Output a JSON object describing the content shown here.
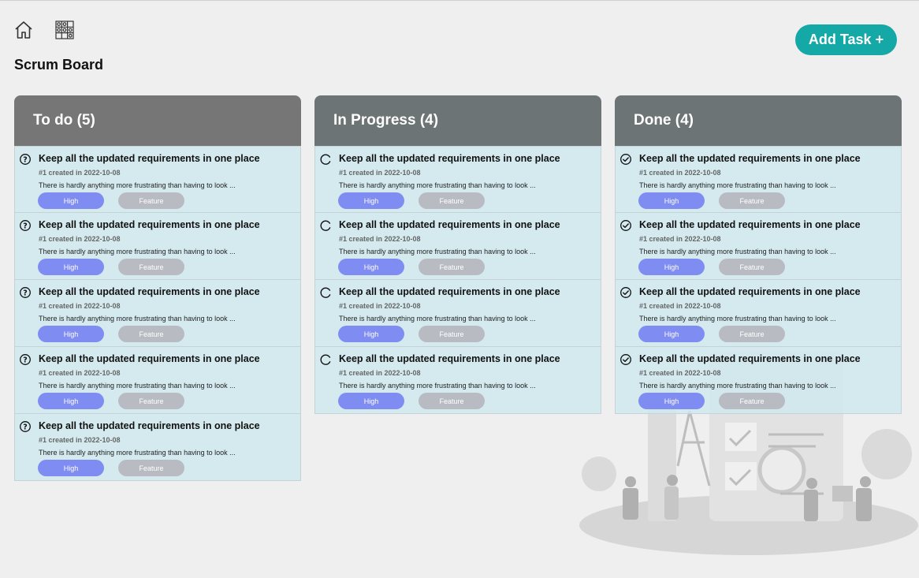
{
  "page": {
    "title": "Scrum Board"
  },
  "toolbar": {
    "add_task_label": "Add Task +"
  },
  "card_template": {
    "title": "Keep all the updated requirements in one place",
    "meta": "#1 created in 2022-10-08",
    "description": "There is hardly anything more frustrating than having to look ...",
    "priority": "High",
    "type": "Feature"
  },
  "colors": {
    "todo_header": "#767676",
    "progress_header": "#6d7475",
    "done_header": "#6d7475",
    "accent": "#14a8a7",
    "priority_pill": "#7f8df2",
    "type_pill": "#b9bbc3"
  },
  "columns": [
    {
      "name": "To do",
      "count_label": "(5)",
      "icon": "question-circle-icon"
    },
    {
      "name": "In Progress",
      "count_label": "(4)",
      "icon": "progress-spinner-icon"
    },
    {
      "name": "Done",
      "count_label": "(4)",
      "icon": "check-circle-icon"
    }
  ],
  "cards": {
    "todo": [
      {
        "title": "Keep all the updated requirements in one place",
        "meta": "#1 created in 2022-10-08",
        "description": "There is hardly anything more frustrating than having to look ...",
        "priority": "High",
        "type": "Feature"
      },
      {
        "title": "Keep all the updated requirements in one place",
        "meta": "#1 created in 2022-10-08",
        "description": "There is hardly anything more frustrating than having to look ...",
        "priority": "High",
        "type": "Feature"
      },
      {
        "title": "Keep all the updated requirements in one place",
        "meta": "#1 created in 2022-10-08",
        "description": "There is hardly anything more frustrating than having to look ...",
        "priority": "High",
        "type": "Feature"
      },
      {
        "title": "Keep all the updated requirements in one place",
        "meta": "#1 created in 2022-10-08",
        "description": "There is hardly anything more frustrating than having to look ...",
        "priority": "High",
        "type": "Feature"
      },
      {
        "title": "Keep all the updated requirements in one place",
        "meta": "#1 created in 2022-10-08",
        "description": "There is hardly anything more frustrating than having to look ...",
        "priority": "High",
        "type": "Feature"
      }
    ],
    "progress": [
      {
        "title": "Keep all the updated requirements in one place",
        "meta": "#1 created in 2022-10-08",
        "description": "There is hardly anything more frustrating than having to look ...",
        "priority": "High",
        "type": "Feature"
      },
      {
        "title": "Keep all the updated requirements in one place",
        "meta": "#1 created in 2022-10-08",
        "description": "There is hardly anything more frustrating than having to look ...",
        "priority": "High",
        "type": "Feature"
      },
      {
        "title": "Keep all the updated requirements in one place",
        "meta": "#1 created in 2022-10-08",
        "description": "There is hardly anything more frustrating than having to look ...",
        "priority": "High",
        "type": "Feature"
      },
      {
        "title": "Keep all the updated requirements in one place",
        "meta": "#1 created in 2022-10-08",
        "description": "There is hardly anything more frustrating than having to look ...",
        "priority": "High",
        "type": "Feature"
      }
    ],
    "done": [
      {
        "title": "Keep all the updated requirements in one place",
        "meta": "#1 created in 2022-10-08",
        "description": "There is hardly anything more frustrating than having to look ...",
        "priority": "High",
        "type": "Feature"
      },
      {
        "title": "Keep all the updated requirements in one place",
        "meta": "#1 created in 2022-10-08",
        "description": "There is hardly anything more frustrating than having to look ...",
        "priority": "High",
        "type": "Feature"
      },
      {
        "title": "Keep all the updated requirements in one place",
        "meta": "#1 created in 2022-10-08",
        "description": "There is hardly anything more frustrating than having to look ...",
        "priority": "High",
        "type": "Feature"
      },
      {
        "title": "Keep all the updated requirements in one place",
        "meta": "#1 created in 2022-10-08",
        "description": "There is hardly anything more frustrating than having to look ...",
        "priority": "High",
        "type": "Feature"
      }
    ]
  }
}
